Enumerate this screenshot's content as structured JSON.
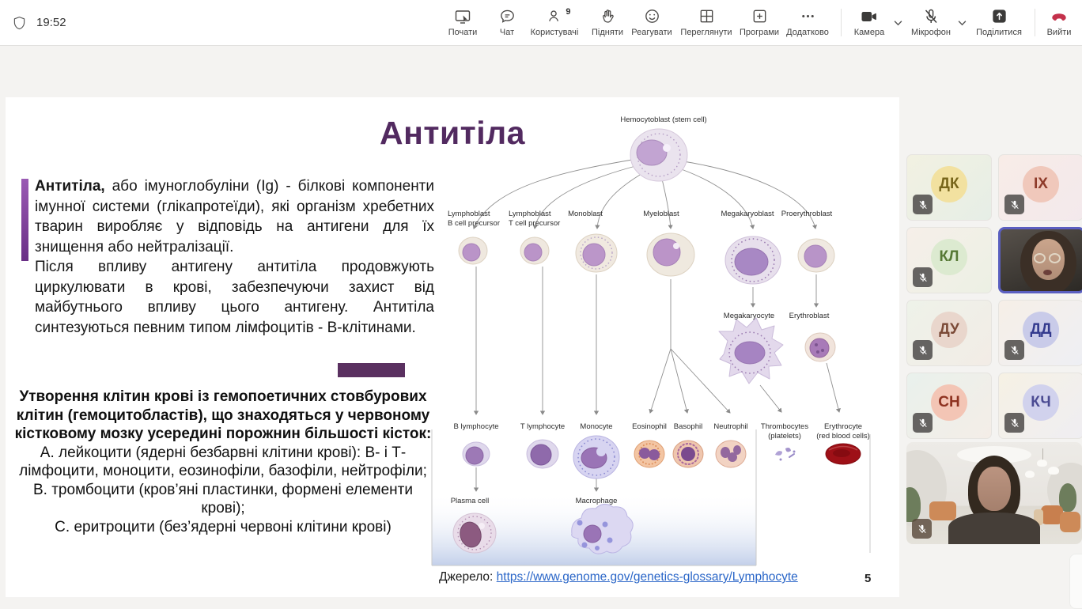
{
  "header": {
    "time": "19:52",
    "items": [
      {
        "id": "start",
        "label": "Почати"
      },
      {
        "id": "chat",
        "label": "Чат"
      },
      {
        "id": "people",
        "label": "Користувачі",
        "badge": "9"
      },
      {
        "id": "raise",
        "label": "Підняти"
      },
      {
        "id": "react",
        "label": "Реагувати"
      },
      {
        "id": "view",
        "label": "Переглянути"
      },
      {
        "id": "apps",
        "label": "Програми"
      },
      {
        "id": "more",
        "label": "Додатково"
      },
      {
        "id": "camera",
        "label": "Камера"
      },
      {
        "id": "mic",
        "label": "Мікрофон"
      },
      {
        "id": "share",
        "label": "Поділитися"
      },
      {
        "id": "leave",
        "label": "Вийти"
      }
    ]
  },
  "slide": {
    "title": "Антитіла",
    "p1_lead": "Антитіла,",
    "p1_rest": " або імуноглобуліни (Ig) - білкові компоненти імунної системи (глікапротеїди), які організм хребетних тварин виробляє у відповідь на антигени для їх знищення або нейтралізації.",
    "p2": "Після впливу антигену антитіла продовжують циркулювати в крові, забезпечуючи захист від майбутнього впливу цього антигену. Антитіла синтезуються певним типом лімфоцитів - В-клітинами.",
    "heading": "Утворення клітин крові із гемопоетичних стовбурових клітин (гемоцитобластів), що знаходяться у червоному кістковому мозку усередині порожнин більшості кісток:",
    "item_a": "А. лейкоцити (ядерні безбарвні клітини крові): В- і Т-лімфоцити, моноцити, еозинофіли, базофіли, нейтрофіли;",
    "item_b": "В. тромбоцити (кров’яні пластинки, формені елементи крові);",
    "item_c": "С. еритроцити (без’ядерні червоні клітини крові)",
    "source_label": "Джерело:",
    "source_link": "https://www.genome.gov/genetics-glossary/Lymphocyte",
    "page_number": "5",
    "colors": {
      "title": "#522a60",
      "accent_bar": "#7d4396",
      "accent_rect": "#5a3060",
      "link": "#2a66c8"
    }
  },
  "diagram": {
    "root": "Hemocytoblast (stem cell)",
    "lymphoblast_b_1": "Lymphoblast",
    "lymphoblast_b_2": "B cell precursor",
    "lymphoblast_t_1": "Lymphoblast",
    "lymphoblast_t_2": "T cell precursor",
    "monoblast": "Monoblast",
    "myeloblast": "Myeloblast",
    "megakaryoblast": "Megakaryoblast",
    "proerythroblast": "Proerythroblast",
    "megakaryocyte": "Megakaryocyte",
    "erythroblast": "Erythroblast",
    "b_lymphocyte": "B lymphocyte",
    "t_lymphocyte": "T lymphocyte",
    "monocyte": "Monocyte",
    "eosinophil": "Eosinophil",
    "basophil": "Basophil",
    "neutrophil": "Neutrophil",
    "thrombocytes_1": "Thrombocytes",
    "thrombocytes_2": "(platelets)",
    "erythrocyte_1": "Erythrocyte",
    "erythrocyte_2": "(red blood cells)",
    "plasma_cell": "Plasma cell",
    "macrophage": "Macrophage"
  },
  "participants": [
    {
      "initials": "ДК",
      "muted": true,
      "tile_style": "background:linear-gradient(135deg,#f2f1e2,#e6eee6)",
      "avatar_style": "background:#f2e1a0;color:#77651a"
    },
    {
      "initials": "ІХ",
      "muted": true,
      "tile_style": "background:linear-gradient(135deg,#f8ece7,#f3e9ec)",
      "avatar_style": "background:#f0c8bb;color:#8e3b2a"
    },
    {
      "initials": "КЛ",
      "muted": true,
      "tile_style": "background:linear-gradient(135deg,#f6efe9,#ecf0e4)",
      "avatar_style": "background:#dcead0;color:#567834"
    },
    {
      "initials": "",
      "muted": false,
      "speaking": true,
      "video": true,
      "border_color": "#5a5fc0"
    },
    {
      "initials": "ДУ",
      "muted": true,
      "tile_style": "background:linear-gradient(135deg,#eef2e9,#f2ece6)",
      "avatar_style": "background:#e9d6cc;color:#7b4a37"
    },
    {
      "initials": "ДД",
      "muted": true,
      "tile_style": "background:linear-gradient(135deg,#f6efe7,#eeeff4)",
      "avatar_style": "background:#c9cbe9;color:#333a8e"
    },
    {
      "initials": "СН",
      "muted": true,
      "tile_style": "background:linear-gradient(135deg,#e9f1ec,#f4ede7)",
      "avatar_style": "background:#f3c5b5;color:#8e3220"
    },
    {
      "initials": "КЧ",
      "muted": true,
      "tile_style": "background:linear-gradient(135deg,#f6f1e4,#efeef2)",
      "avatar_style": "background:#d1d2ed;color:#4b4b92"
    },
    {
      "initials": "",
      "muted": true,
      "video": true,
      "role": "teacher-camera"
    }
  ]
}
